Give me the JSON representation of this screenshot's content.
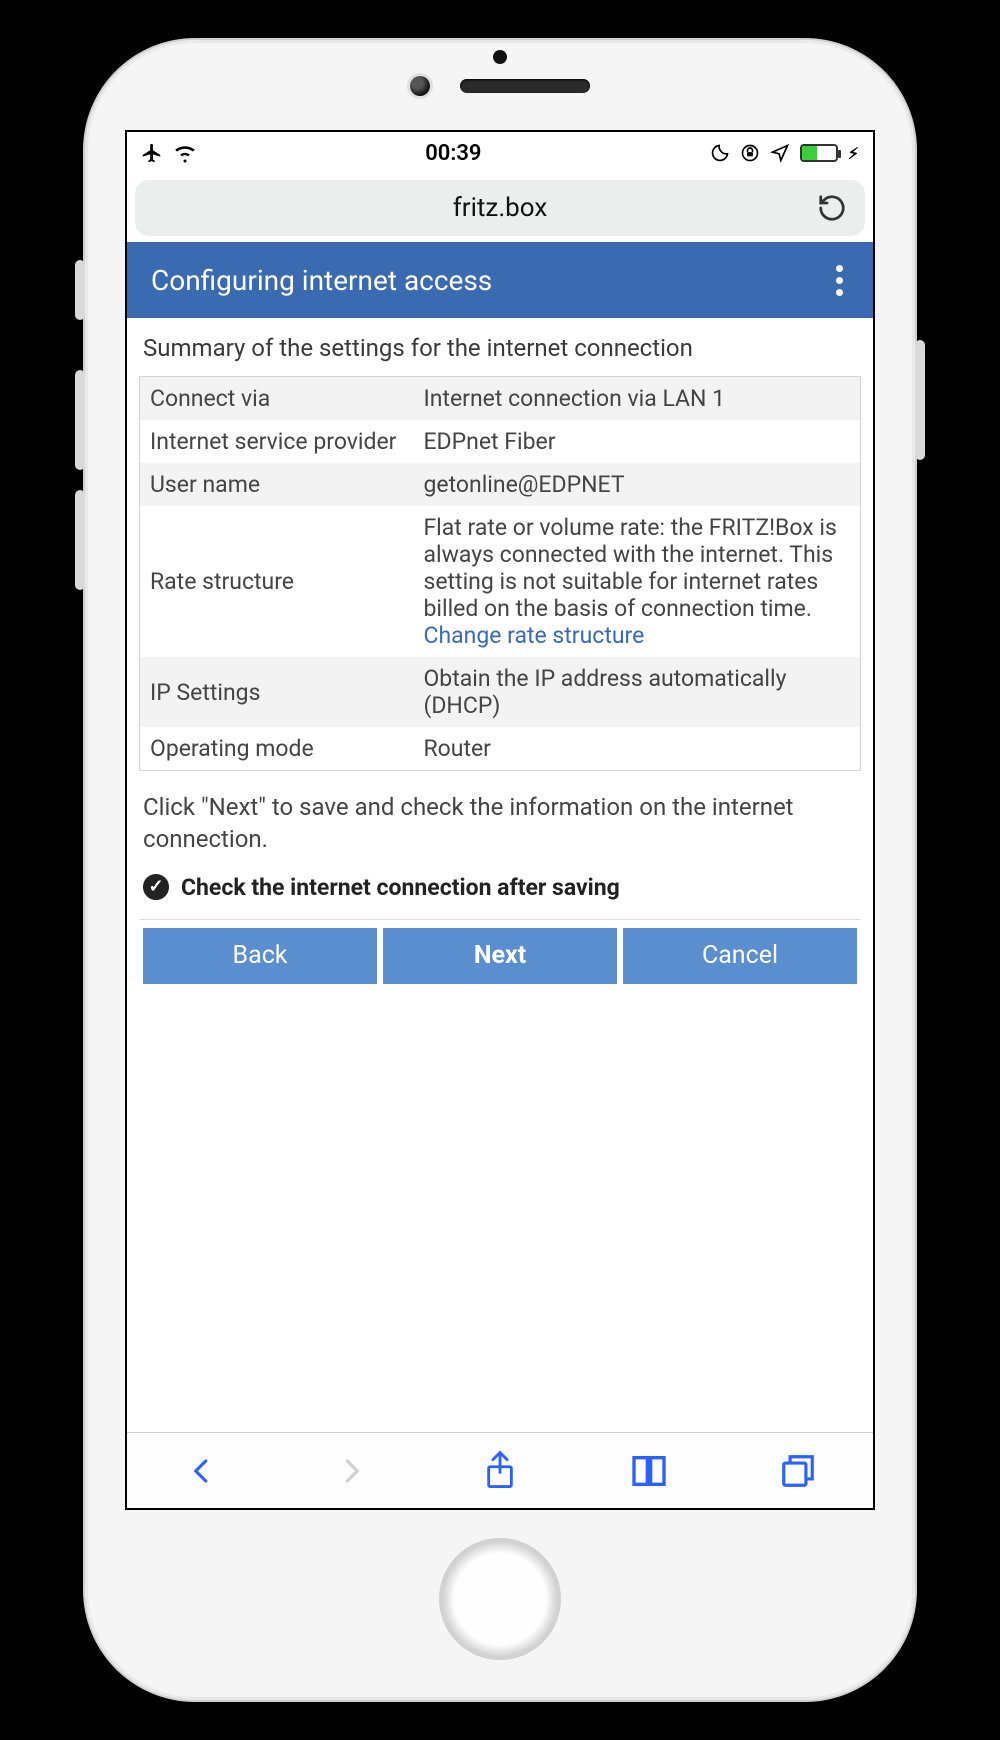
{
  "statusbar": {
    "time": "00:39"
  },
  "browser": {
    "url": "fritz.box"
  },
  "appbar": {
    "title": "Configuring internet access"
  },
  "summary": {
    "heading": "Summary of the settings for the internet connection",
    "rows": [
      {
        "label": "Connect via",
        "value": "Internet connection via LAN 1"
      },
      {
        "label": "Internet service provider",
        "value": "EDPnet Fiber"
      },
      {
        "label": "User name",
        "value": "getonline@EDPNET"
      },
      {
        "label": "Rate structure",
        "value": "Flat rate or volume rate: the FRITZ!Box is always connected with the internet. This setting is not suitable for internet rates billed on the basis of connection time. ",
        "link": "Change rate structure"
      },
      {
        "label": "IP Settings",
        "value": "Obtain the IP address automatically (DHCP)"
      },
      {
        "label": "Operating mode",
        "value": "Router"
      }
    ]
  },
  "instruction": "Click \"Next\" to save and check the information on the internet connection.",
  "checkbox": {
    "label": "Check the internet connection after saving"
  },
  "buttons": {
    "back": "Back",
    "next": "Next",
    "cancel": "Cancel"
  }
}
